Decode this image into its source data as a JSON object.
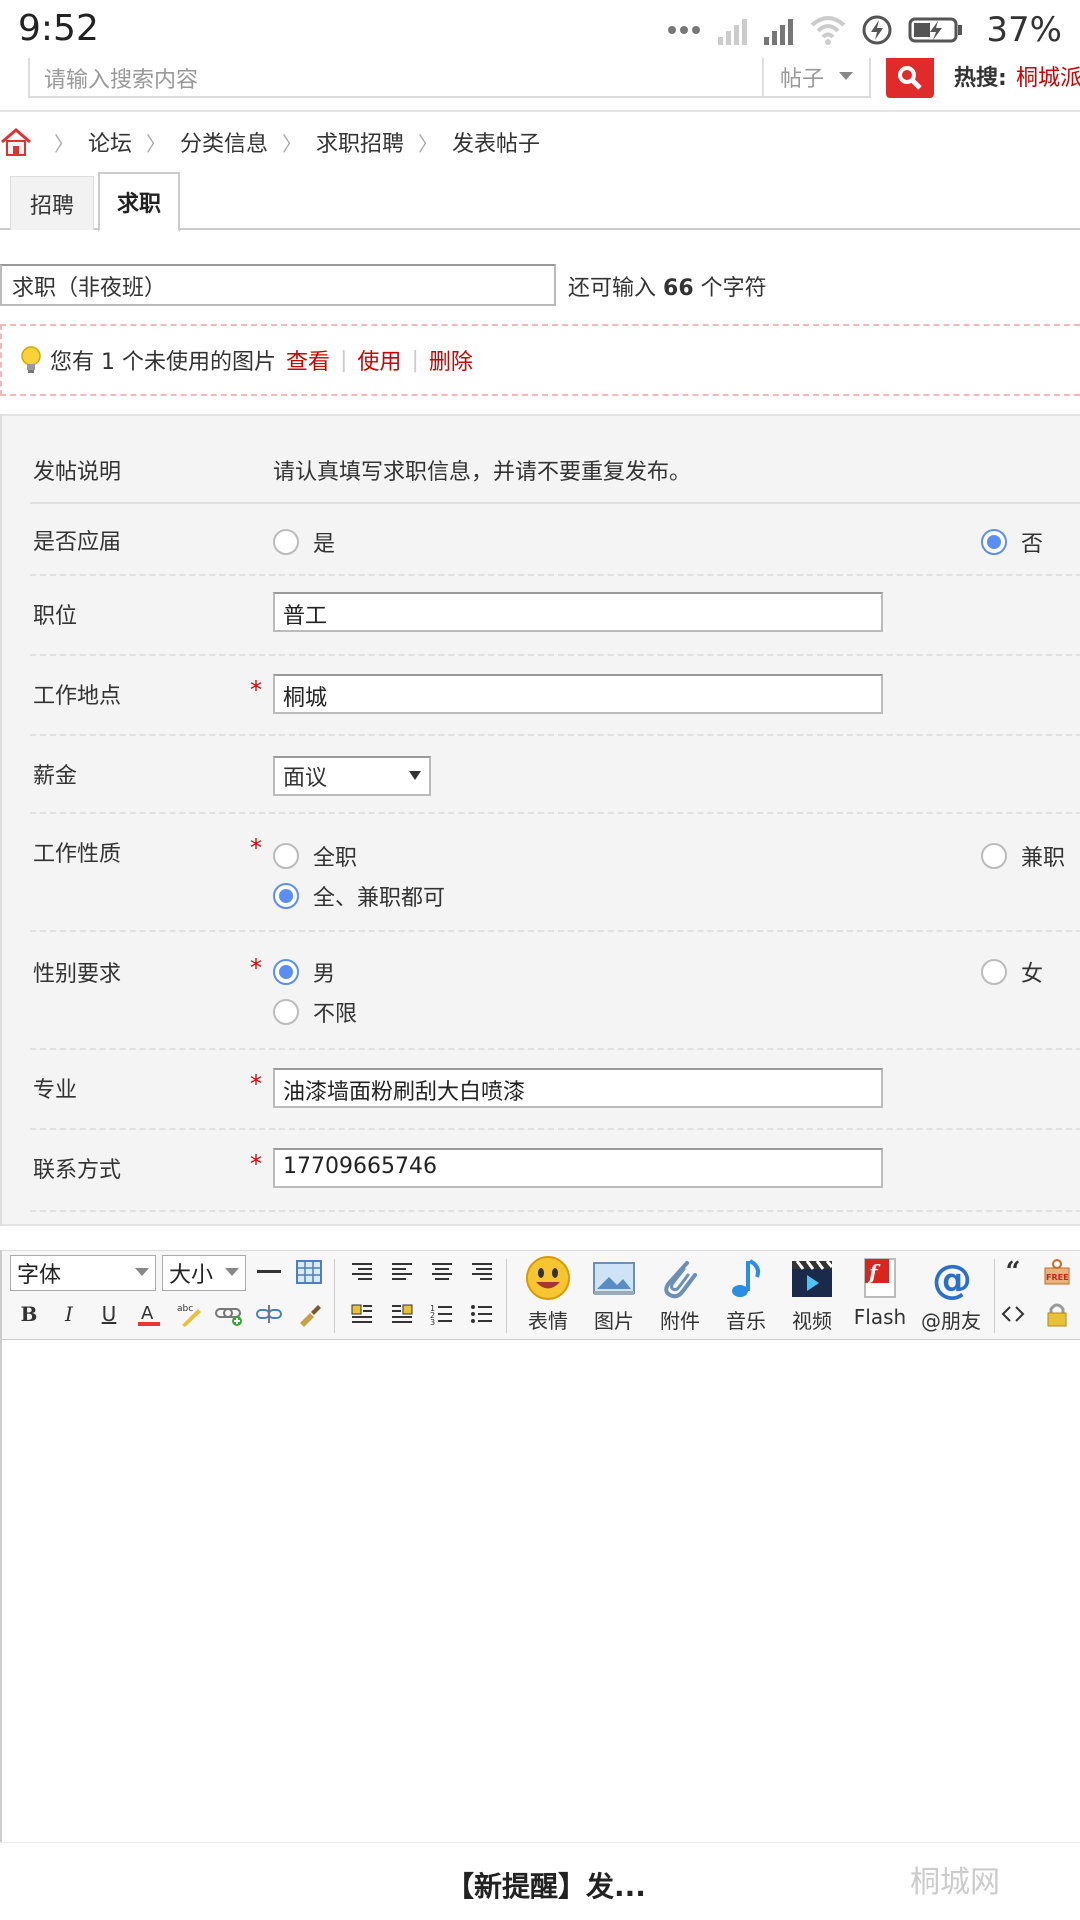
{
  "status_bar": {
    "time": "9:52",
    "battery_pct": "37%"
  },
  "search": {
    "placeholder": "请输入搜索内容",
    "type": "帖子",
    "hot_label": "热搜:",
    "hot_link": "桐城派"
  },
  "breadcrumb": [
    "论坛",
    "分类信息",
    "求职招聘",
    "发表帖子"
  ],
  "tabs": [
    {
      "label": "招聘",
      "active": false
    },
    {
      "label": "求职",
      "active": true
    }
  ],
  "title": {
    "value": "求职（非夜班）",
    "hint_pre": "还可输入",
    "hint_count": "66",
    "hint_post": "个字符"
  },
  "notice": {
    "text": "您有 1 个未使用的图片",
    "view": "查看",
    "use": "使用",
    "delete": "删除"
  },
  "form": {
    "desc_label": "发帖说明",
    "desc_text": "请认真填写求职信息，并请不要重复发布。",
    "graduate_label": "是否应届",
    "graduate_yes": "是",
    "graduate_no": "否",
    "position_label": "职位",
    "position_value": "普工",
    "location_label": "工作地点",
    "location_value": "桐城",
    "salary_label": "薪金",
    "salary_value": "面议",
    "nature_label": "工作性质",
    "nature_full": "全职",
    "nature_part": "兼职",
    "nature_both": "全、兼职都可",
    "gender_label": "性别要求",
    "gender_male": "男",
    "gender_female": "女",
    "gender_any": "不限",
    "major_label": "专业",
    "major_value": "油漆墙面粉刷刮大白喷漆",
    "contact_label": "联系方式",
    "contact_value": "17709665746",
    "required_mark": "*"
  },
  "editor": {
    "font_label": "字体",
    "size_label": "大小",
    "emoji": "表情",
    "image": "图片",
    "attachment": "附件",
    "music": "音乐",
    "video": "视频",
    "flash": "Flash",
    "mention": "@朋友"
  },
  "bottom": {
    "text": "【新提醒】发...",
    "watermark": "桐城网"
  }
}
